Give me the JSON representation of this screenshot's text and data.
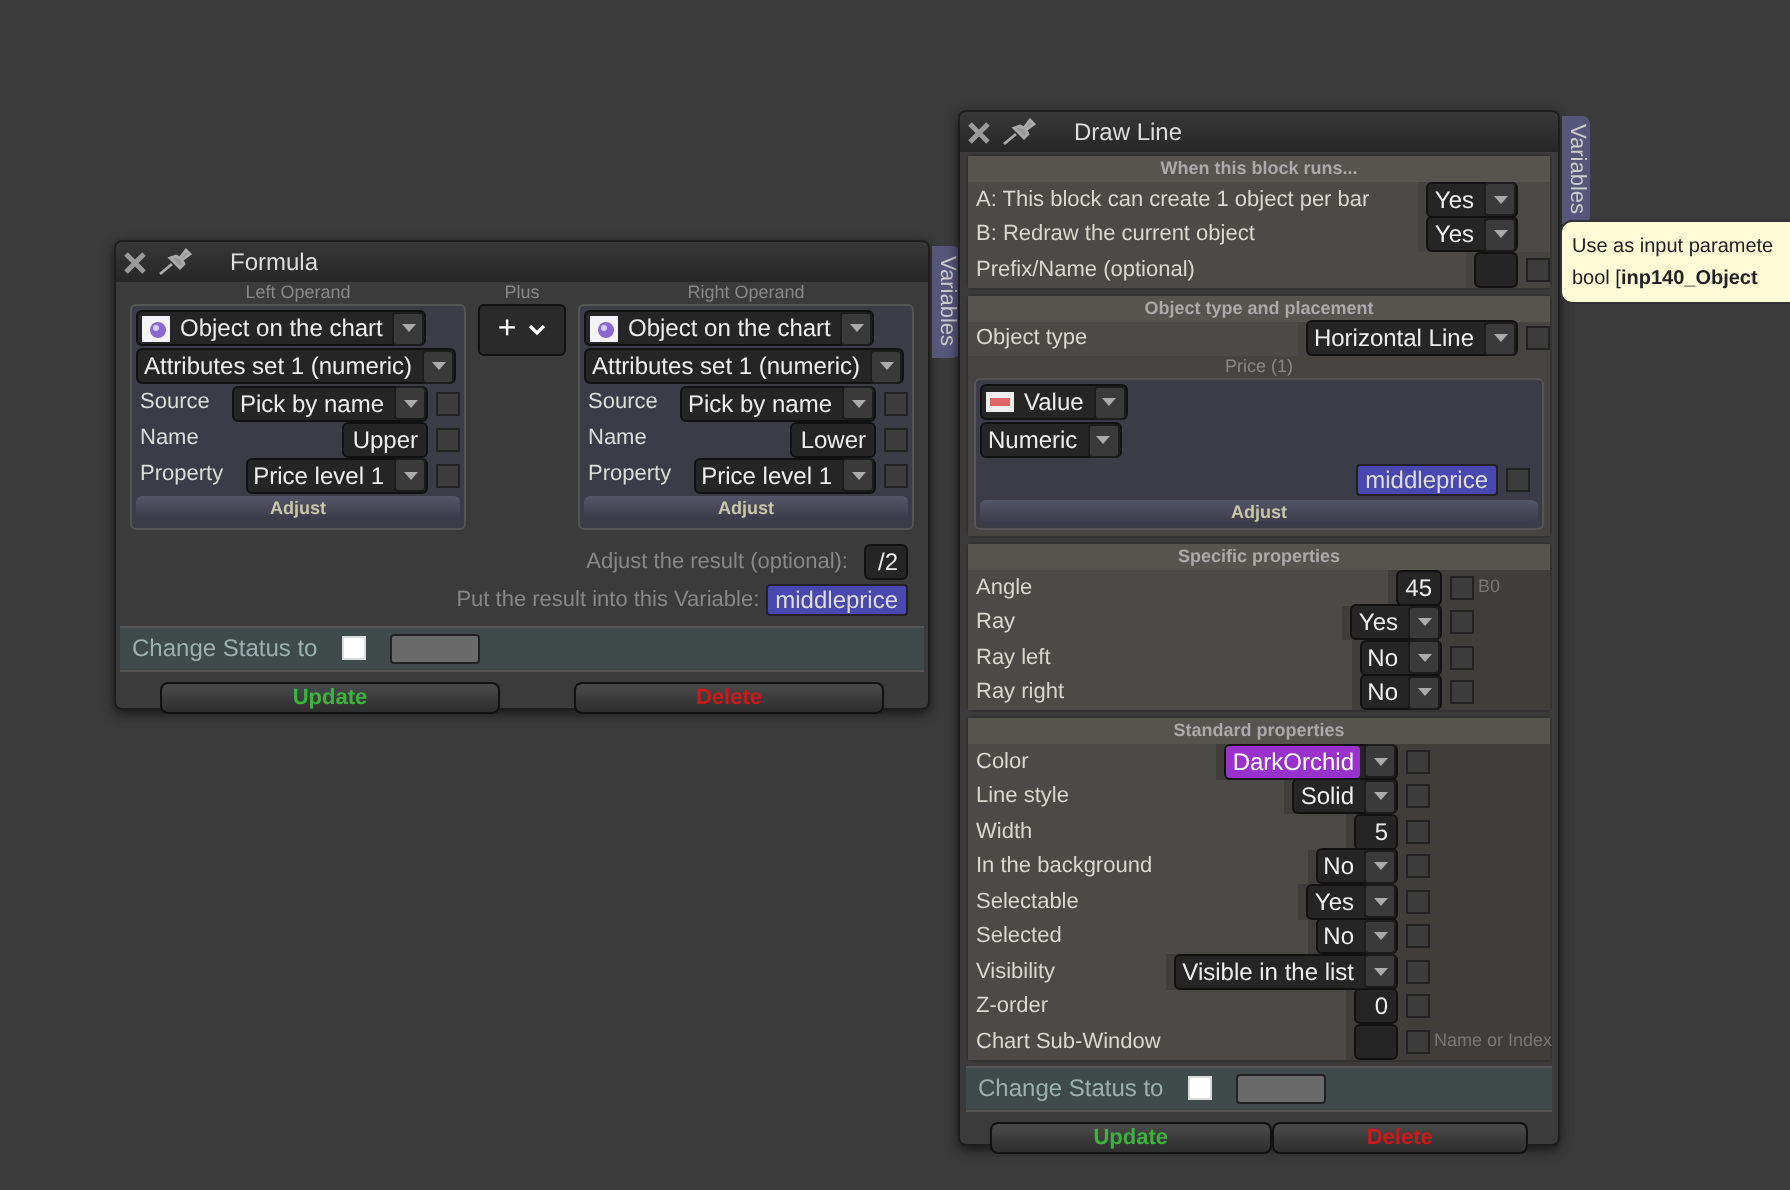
{
  "formula": {
    "title": "Formula",
    "variables_tab": "Variables",
    "operands": [
      {
        "heading": "Left Operand",
        "source_type": "Object on the chart",
        "attributes": "Attributes set 1 (numeric)",
        "rows": [
          {
            "label": "Source",
            "kind": "select",
            "value": "Pick by name",
            "checked": false
          },
          {
            "label": "Name",
            "kind": "text",
            "value": "Upper",
            "checked": false
          },
          {
            "label": "Property",
            "kind": "select",
            "value": "Price level 1",
            "checked": false
          }
        ],
        "adjust": "Adjust"
      },
      {
        "heading": "Right Operand",
        "source_type": "Object on the chart",
        "attributes": "Attributes set 1 (numeric)",
        "rows": [
          {
            "label": "Source",
            "kind": "select",
            "value": "Pick by name",
            "checked": false
          },
          {
            "label": "Name",
            "kind": "text",
            "value": "Lower",
            "checked": false
          },
          {
            "label": "Property",
            "kind": "select",
            "value": "Price level 1",
            "checked": false
          }
        ],
        "adjust": "Adjust"
      }
    ],
    "operator": {
      "heading": "Plus",
      "value": "+"
    },
    "adjust_result": {
      "label": "Adjust the result (optional):",
      "value": "/2"
    },
    "result_variable": {
      "label": "Put the result into this Variable:",
      "value": "middleprice"
    },
    "change_status": {
      "label": "Change Status to",
      "checked": false
    },
    "buttons": [
      {
        "kind": "update",
        "label": "Update"
      },
      {
        "kind": "delete",
        "label": "Delete"
      }
    ]
  },
  "draw_line": {
    "title": "Draw Line",
    "variables_tab": "Variables",
    "sections": [
      {
        "heading": "When this block runs...",
        "rows": [
          {
            "label": "A: This block can create 1 object per bar",
            "kind": "select",
            "value": "Yes"
          },
          {
            "label": "B: Redraw the current object",
            "kind": "select",
            "value": "Yes"
          },
          {
            "label": "Prefix/Name (optional)",
            "kind": "text",
            "checked": false
          }
        ]
      },
      {
        "heading": "Object type and placement",
        "rows": [
          {
            "label": "Object type",
            "kind": "select",
            "value": "Horizontal Line",
            "checked": false
          }
        ],
        "price": {
          "heading": "Price (1)",
          "source_type": "Value",
          "format": "Numeric",
          "variable": "middleprice",
          "checked": false,
          "adjust": "Adjust"
        }
      },
      {
        "heading": "Specific properties",
        "rows": [
          {
            "label": "Angle",
            "kind": "text",
            "value": "45",
            "checked": false,
            "note": "B0"
          },
          {
            "label": "Ray",
            "kind": "select",
            "value": "Yes",
            "checked": false
          },
          {
            "label": "Ray left",
            "kind": "select",
            "value": "No",
            "checked": false
          },
          {
            "label": "Ray right",
            "kind": "select",
            "value": "No",
            "checked": false
          }
        ]
      },
      {
        "heading": "Standard properties",
        "rows": [
          {
            "label": "Color",
            "kind": "color_select",
            "value": "DarkOrchid",
            "color": "#9932cc",
            "checked": false
          },
          {
            "label": "Line style",
            "kind": "select",
            "value": "Solid",
            "checked": false
          },
          {
            "label": "Width",
            "kind": "text",
            "value": "5",
            "checked": false
          },
          {
            "label": "In the background",
            "kind": "select",
            "value": "No",
            "checked": false
          },
          {
            "label": "Selectable",
            "kind": "select",
            "value": "Yes",
            "checked": false
          },
          {
            "label": "Selected",
            "kind": "select",
            "value": "No",
            "checked": false
          },
          {
            "label": "Visibility",
            "kind": "select",
            "value": "Visible in the list",
            "checked": false
          },
          {
            "label": "Z-order",
            "kind": "text",
            "value": "0",
            "checked": false
          },
          {
            "label": "Chart Sub-Window",
            "kind": "text",
            "checked": false,
            "note": "Name or Index"
          }
        ]
      }
    ],
    "change_status": {
      "label": "Change Status to",
      "checked": false
    },
    "buttons": [
      {
        "kind": "update",
        "label": "Update"
      },
      {
        "kind": "delete",
        "label": "Delete"
      }
    ]
  },
  "tooltip": {
    "lines": [
      "Use as input paramete",
      "bool [**inp140_Object**"
    ]
  }
}
